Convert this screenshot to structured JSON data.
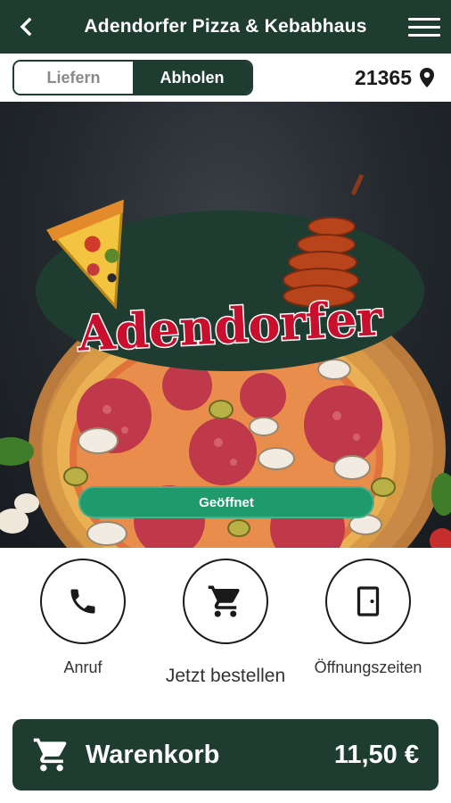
{
  "header": {
    "title": "Adendorfer Pizza & Kebabhaus",
    "back_icon": "chevron-left-icon",
    "menu_icon": "hamburger-menu-icon"
  },
  "mode": {
    "options": [
      "Liefern",
      "Abholen"
    ],
    "selected": "Abholen"
  },
  "location": {
    "zip": "21365",
    "icon": "location-pin-icon"
  },
  "hero": {
    "logo_text": "Adendorfer",
    "status_label": "Geöffnet"
  },
  "actions": [
    {
      "label": "Anruf",
      "icon": "phone-icon"
    },
    {
      "label": "Jetzt bestellen",
      "icon": "cart-icon"
    },
    {
      "label": "Öffnungszeiten",
      "icon": "door-icon"
    }
  ],
  "cart": {
    "label": "Warenkorb",
    "total": "11,50 €",
    "icon": "cart-icon"
  },
  "colors": {
    "primary": "#1e3d30",
    "open_status": "#1e9a6c",
    "logo_red": "#c8102e"
  }
}
